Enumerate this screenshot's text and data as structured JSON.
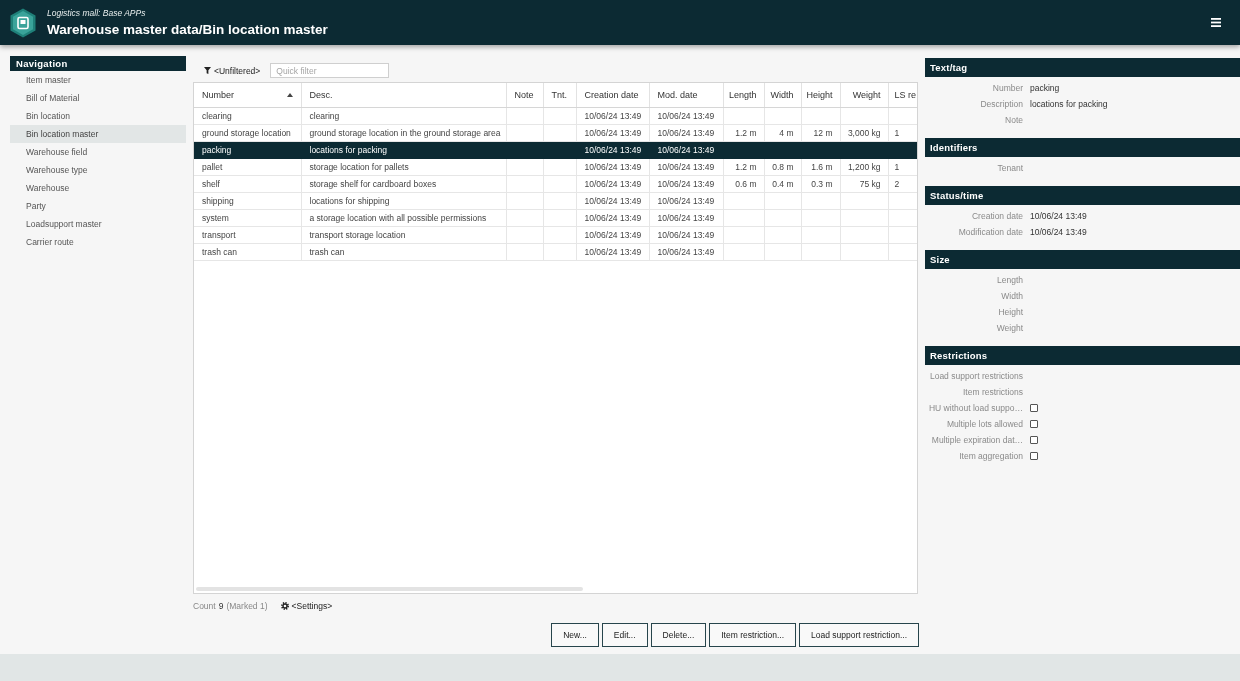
{
  "header": {
    "subtitle": "Logistics mall: Base APPs",
    "title": "Warehouse master data/Bin location master"
  },
  "navigation": {
    "title": "Navigation",
    "items": [
      {
        "label": "Item master",
        "selected": false
      },
      {
        "label": "Bill of Material",
        "selected": false
      },
      {
        "label": "Bin location",
        "selected": false
      },
      {
        "label": "Bin location master",
        "selected": true
      },
      {
        "label": "Warehouse field",
        "selected": false
      },
      {
        "label": "Warehouse type",
        "selected": false
      },
      {
        "label": "Warehouse",
        "selected": false
      },
      {
        "label": "Party",
        "selected": false
      },
      {
        "label": "Loadsupport master",
        "selected": false
      },
      {
        "label": "Carrier route",
        "selected": false
      }
    ]
  },
  "filter": {
    "label": "<Unfiltered>",
    "quick_filter": {
      "placeholder": "Quick filter"
    }
  },
  "table": {
    "columns": [
      {
        "label": "Number",
        "sorted": true
      },
      {
        "label": "Desc.",
        "sorted": false
      },
      {
        "label": "Note",
        "sorted": false
      },
      {
        "label": "Tnt.",
        "sorted": false
      },
      {
        "label": "Creation date",
        "sorted": false
      },
      {
        "label": "Mod. date",
        "sorted": false
      },
      {
        "label": "Length",
        "sorted": false
      },
      {
        "label": "Width",
        "sorted": false
      },
      {
        "label": "Height",
        "sorted": false
      },
      {
        "label": "Weight",
        "sorted": false
      },
      {
        "label": "LS re",
        "sorted": false
      }
    ],
    "rows": [
      {
        "selected": false,
        "cells": [
          "clearing",
          "clearing",
          null,
          null,
          "10/06/24 13:49",
          "10/06/24 13:49",
          null,
          null,
          null,
          null,
          null
        ]
      },
      {
        "selected": false,
        "cells": [
          "ground storage location",
          "ground storage location in the ground storage area",
          null,
          null,
          "10/06/24 13:49",
          "10/06/24 13:49",
          "1.2 m",
          "4 m",
          "12 m",
          "3,000 kg",
          "1"
        ]
      },
      {
        "selected": true,
        "cells": [
          "packing",
          "locations for packing",
          null,
          null,
          "10/06/24 13:49",
          "10/06/24 13:49",
          null,
          null,
          null,
          null,
          null
        ]
      },
      {
        "selected": false,
        "cells": [
          "pallet",
          "storage location for pallets",
          null,
          null,
          "10/06/24 13:49",
          "10/06/24 13:49",
          "1.2 m",
          "0.8 m",
          "1.6 m",
          "1,200 kg",
          "1"
        ]
      },
      {
        "selected": false,
        "cells": [
          "shelf",
          "storage shelf for cardboard boxes",
          null,
          null,
          "10/06/24 13:49",
          "10/06/24 13:49",
          "0.6 m",
          "0.4 m",
          "0.3 m",
          "75 kg",
          "2"
        ]
      },
      {
        "selected": false,
        "cells": [
          "shipping",
          "locations for shipping",
          null,
          null,
          "10/06/24 13:49",
          "10/06/24 13:49",
          null,
          null,
          null,
          null,
          null
        ]
      },
      {
        "selected": false,
        "cells": [
          "system",
          "a storage location with all possible permissions",
          null,
          null,
          "10/06/24 13:49",
          "10/06/24 13:49",
          null,
          null,
          null,
          null,
          null
        ]
      },
      {
        "selected": false,
        "cells": [
          "transport",
          "transport storage location",
          null,
          null,
          "10/06/24 13:49",
          "10/06/24 13:49",
          null,
          null,
          null,
          null,
          null
        ]
      },
      {
        "selected": false,
        "cells": [
          "trash can",
          "trash can",
          null,
          null,
          "10/06/24 13:49",
          "10/06/24 13:49",
          null,
          null,
          null,
          null,
          null
        ]
      }
    ]
  },
  "summary": {
    "count_label": "Count",
    "count": "9",
    "marked": "(Marked 1)",
    "settings": "<Settings>"
  },
  "buttons": [
    "New...",
    "Edit...",
    "Delete...",
    "Item restriction...",
    "Load support restriction..."
  ],
  "details": {
    "sections": [
      {
        "title": "Text/tag",
        "fields": [
          {
            "kind": "text",
            "label": "Number",
            "value": "packing"
          },
          {
            "kind": "text",
            "label": "Description",
            "value": "locations for packing"
          },
          {
            "kind": "text",
            "label": "Note"
          }
        ]
      },
      {
        "title": "Identifiers",
        "fields": [
          {
            "kind": "text",
            "label": "Tenant"
          }
        ]
      },
      {
        "title": "Status/time",
        "fields": [
          {
            "kind": "text",
            "label": "Creation date",
            "value": "10/06/24 13:49"
          },
          {
            "kind": "text",
            "label": "Modification date",
            "value": "10/06/24 13:49"
          }
        ]
      },
      {
        "title": "Size",
        "fields": [
          {
            "kind": "text",
            "label": "Length"
          },
          {
            "kind": "text",
            "label": "Width"
          },
          {
            "kind": "text",
            "label": "Height"
          },
          {
            "kind": "text",
            "label": "Weight"
          }
        ]
      },
      {
        "title": "Restrictions",
        "fields": [
          {
            "kind": "text",
            "label": "Load support restrictions"
          },
          {
            "kind": "text",
            "label": "Item restrictions"
          },
          {
            "kind": "checkbox",
            "label": "HU without load suppo…",
            "checked": false
          },
          {
            "kind": "checkbox",
            "label": "Multiple lots allowed",
            "checked": false
          },
          {
            "kind": "checkbox",
            "label": "Multiple expiration dat…",
            "checked": false
          },
          {
            "kind": "checkbox",
            "label": "Item aggregation",
            "checked": false
          }
        ]
      }
    ]
  }
}
